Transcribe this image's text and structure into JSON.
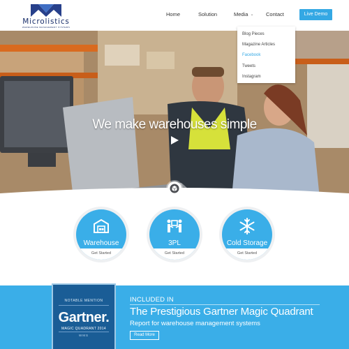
{
  "brand": {
    "name": "Microlistics",
    "tagline": "WAREHOUSE MANAGEMENT SYSTEMS"
  },
  "nav": {
    "home": "Home",
    "solution": "Solution",
    "media": "Media",
    "contact": "Contact",
    "cta": "Live Demo"
  },
  "media_menu": {
    "items": [
      "Blog Pieces",
      "Magazine Articles",
      "Facebook",
      "Tweets",
      "Instagram"
    ],
    "active": "Facebook"
  },
  "hero": {
    "headline": "We make warehouses simple",
    "play_icon": "play-icon",
    "scroll_icon": "cube-icon"
  },
  "services": [
    {
      "label": "Warehouse",
      "cta": "Get Started",
      "icon": "warehouse-icon"
    },
    {
      "label": "3PL",
      "cta": "Get Started",
      "icon": "handover-icon"
    },
    {
      "label": "Cold Storage",
      "cta": "Get Started",
      "icon": "snowflake-icon"
    }
  ],
  "gartner": {
    "badge_top": "NOTABLE MENTION",
    "badge_brand": "Gartner.",
    "badge_mq": "MAGIC QUADRANT 2014",
    "badge_wms": "WMS",
    "kicker": "INCLUDED IN",
    "title": "The Prestigious Gartner Magic Quadrant",
    "subtitle": "Report for warehouse management systems",
    "button": "Read More"
  },
  "colors": {
    "accent": "#34a8e4",
    "brand_navy": "#1a2f6b",
    "badge_blue": "#1a5d96"
  }
}
